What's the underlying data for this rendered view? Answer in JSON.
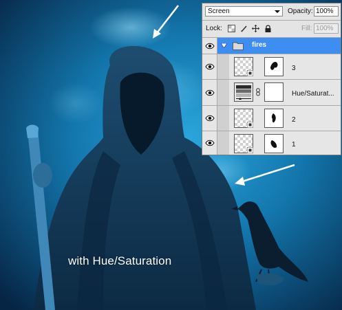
{
  "caption": "with Hue/Saturation",
  "layers_panel": {
    "blend_mode": "Screen",
    "opacity_label": "Opacity:",
    "opacity_value": "100%",
    "lock_label": "Lock:",
    "fill_label": "Fill:",
    "fill_value": "100%",
    "layers": [
      {
        "name": "fires",
        "type": "group",
        "selected": true,
        "expanded": true,
        "visible": true
      },
      {
        "name": "3",
        "type": "smart-object-with-mask",
        "visible": true
      },
      {
        "name": "Hue/Saturat...",
        "type": "adjustment-hue-saturation",
        "visible": true
      },
      {
        "name": "2",
        "type": "smart-object-with-mask",
        "visible": true
      },
      {
        "name": "1",
        "type": "smart-object-with-mask",
        "visible": true
      }
    ]
  },
  "icons": [
    "eye-icon",
    "folder-icon",
    "expand-triangle-icon",
    "link-icon",
    "smart-object-icon",
    "lock-transparency-icon",
    "lock-image-icon",
    "lock-position-icon",
    "lock-all-icon",
    "arrow-icon"
  ],
  "colors": {
    "scene_blue": "#1f90c8",
    "scene_dark": "#06213a",
    "selection_blue": "#3d8ef0",
    "panel_bg": "#d6d6d6"
  }
}
